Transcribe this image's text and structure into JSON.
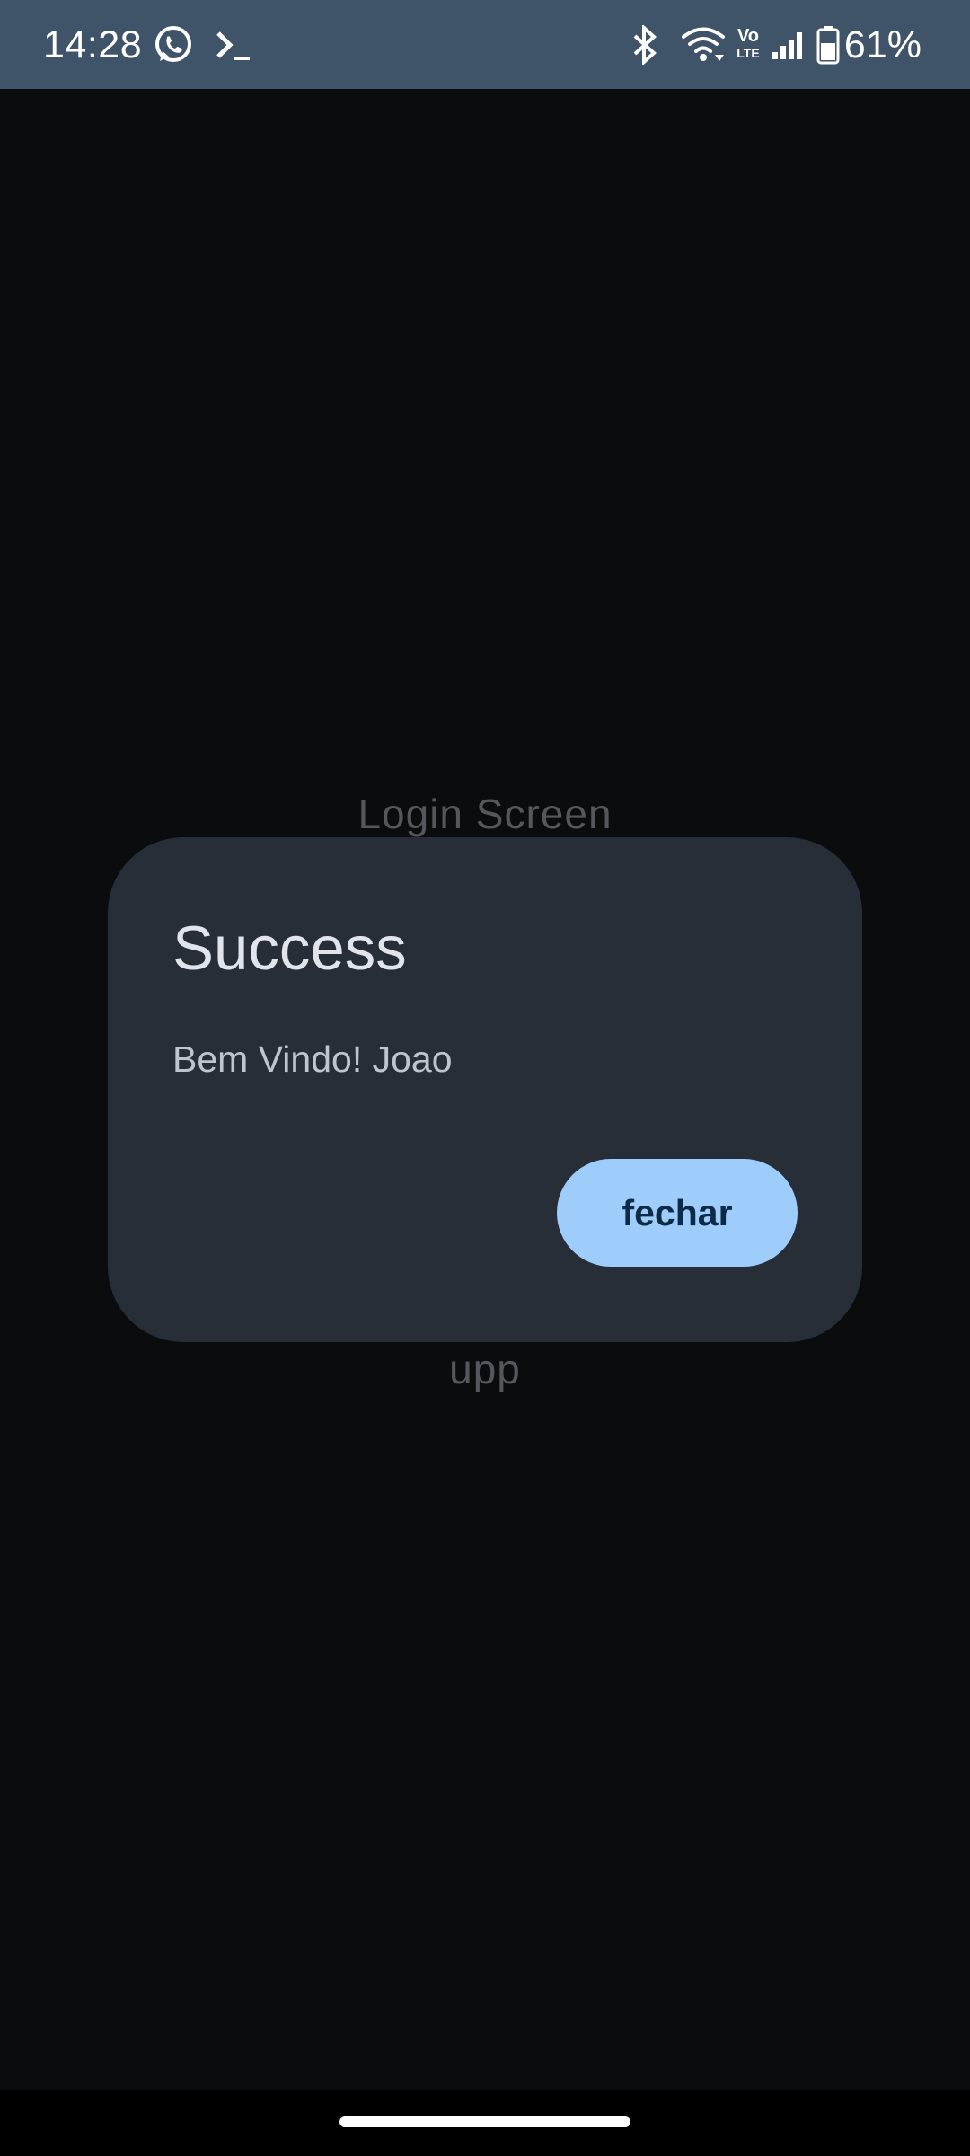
{
  "status_bar": {
    "time": "14:28",
    "battery_percent": "61%",
    "left_icons": [
      "whatsapp-icon",
      "terminal-icon"
    ],
    "right_icons": [
      "bluetooth-icon",
      "wifi-icon",
      "volte-icon",
      "signal-icon",
      "battery-icon"
    ],
    "volte_label_top": "Vo",
    "volte_label_bottom": "LTE",
    "battery_level": 0.61,
    "background_color": "#3f5468"
  },
  "background": {
    "title": "Login Screen",
    "bottom_text": "upp"
  },
  "dialog": {
    "title": "Success",
    "message": "Bem Vindo! Joao",
    "button_label": "fechar",
    "background_color": "#272e38",
    "button_color": "#9fcdfb"
  },
  "navigation": {
    "handle": "gesture-handle"
  }
}
